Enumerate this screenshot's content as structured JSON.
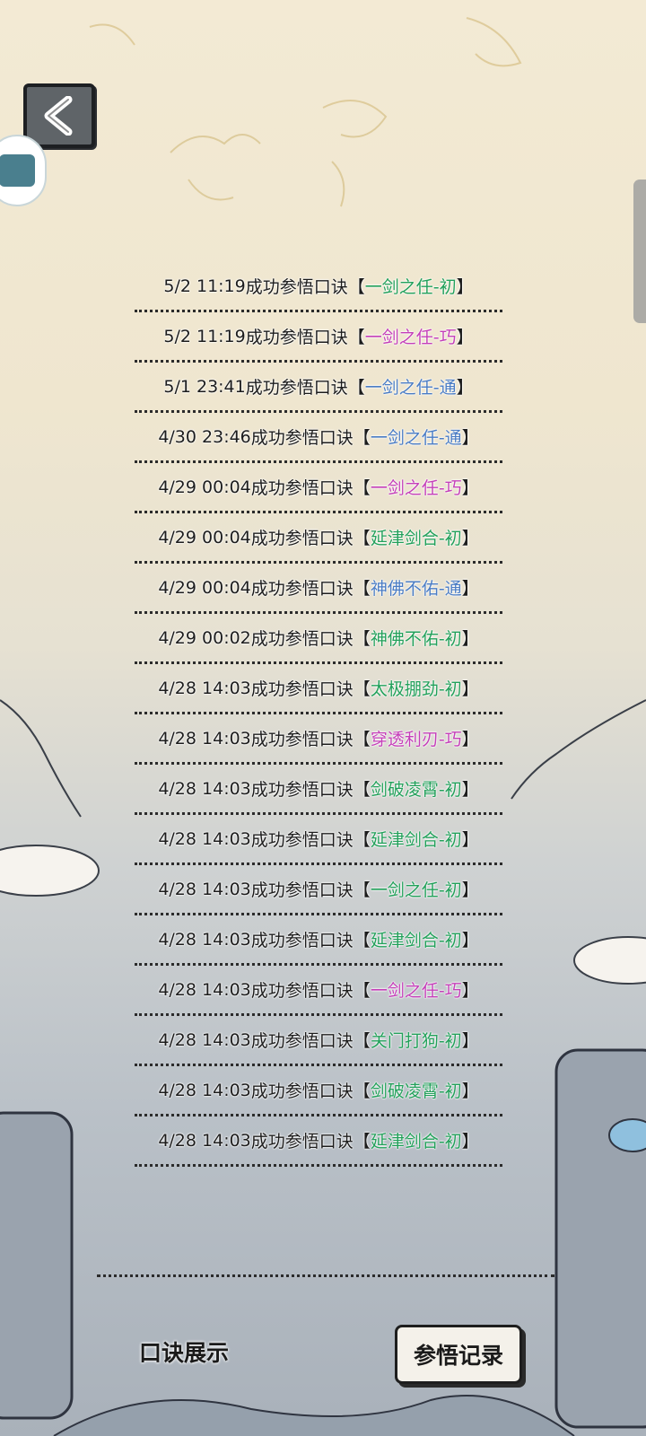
{
  "colors": {
    "tier_初": "#22a05a",
    "tier_巧": "#c43fb8",
    "tier_通": "#4a7cc4"
  },
  "back_icon": "chevron-left-icon",
  "records": [
    {
      "time": "5/2 11:19",
      "action": "成功参悟口诀",
      "skill": "一剑之任-初",
      "tier": "green"
    },
    {
      "time": "5/2 11:19",
      "action": "成功参悟口诀",
      "skill": "一剑之任-巧",
      "tier": "pink"
    },
    {
      "time": "5/1 23:41",
      "action": "成功参悟口诀",
      "skill": "一剑之任-通",
      "tier": "blue"
    },
    {
      "time": "4/30 23:46",
      "action": "成功参悟口诀",
      "skill": "一剑之任-通",
      "tier": "blue"
    },
    {
      "time": "4/29 00:04",
      "action": "成功参悟口诀",
      "skill": "一剑之任-巧",
      "tier": "pink"
    },
    {
      "time": "4/29 00:04",
      "action": "成功参悟口诀",
      "skill": "延津剑合-初",
      "tier": "green"
    },
    {
      "time": "4/29 00:04",
      "action": "成功参悟口诀",
      "skill": "神佛不佑-通",
      "tier": "blue"
    },
    {
      "time": "4/29 00:02",
      "action": "成功参悟口诀",
      "skill": "神佛不佑-初",
      "tier": "green"
    },
    {
      "time": "4/28 14:03",
      "action": "成功参悟口诀",
      "skill": "太极掤劲-初",
      "tier": "green"
    },
    {
      "time": "4/28 14:03",
      "action": "成功参悟口诀",
      "skill": "穿透利刃-巧",
      "tier": "pink"
    },
    {
      "time": "4/28 14:03",
      "action": "成功参悟口诀",
      "skill": "剑破凌霄-初",
      "tier": "green"
    },
    {
      "time": "4/28 14:03",
      "action": "成功参悟口诀",
      "skill": "延津剑合-初",
      "tier": "green"
    },
    {
      "time": "4/28 14:03",
      "action": "成功参悟口诀",
      "skill": "一剑之任-初",
      "tier": "green"
    },
    {
      "time": "4/28 14:03",
      "action": "成功参悟口诀",
      "skill": "延津剑合-初",
      "tier": "green"
    },
    {
      "time": "4/28 14:03",
      "action": "成功参悟口诀",
      "skill": "一剑之任-巧",
      "tier": "pink"
    },
    {
      "time": "4/28 14:03",
      "action": "成功参悟口诀",
      "skill": "关门打狗-初",
      "tier": "green"
    },
    {
      "time": "4/28 14:03",
      "action": "成功参悟口诀",
      "skill": "剑破凌霄-初",
      "tier": "green"
    },
    {
      "time": "4/28 14:03",
      "action": "成功参悟口诀",
      "skill": "延津剑合-初",
      "tier": "green"
    }
  ],
  "brackets": {
    "open": "【",
    "close": "】"
  },
  "tabs": {
    "display": "口诀展示",
    "records": "参悟记录"
  }
}
